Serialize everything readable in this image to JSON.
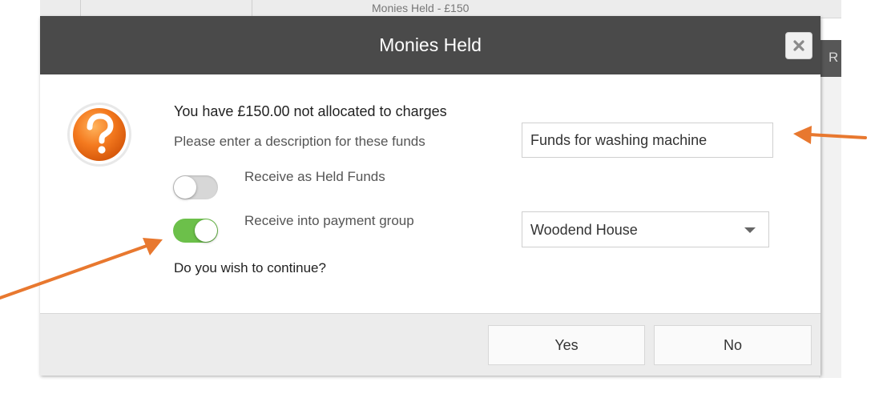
{
  "background": {
    "header_text": "Monies Held - £150",
    "right_tab_char": "R"
  },
  "dialog": {
    "title": "Monies Held",
    "close_icon": "close-icon",
    "question_icon": "question-icon",
    "message": "You have £150.00 not allocated to charges",
    "description_prompt": "Please enter a description for these funds",
    "description_value": "Funds for washing machine",
    "held_funds_label": "Receive as Held Funds",
    "held_funds_on": false,
    "payment_group_label": "Receive into payment group",
    "payment_group_on": true,
    "payment_group_selected": "Woodend House",
    "continue_prompt": "Do you wish to continue?",
    "yes_label": "Yes",
    "no_label": "No"
  },
  "colors": {
    "titlebar": "#4a4a4a",
    "toggle_on": "#6cc04a",
    "toggle_off": "#d7d7d7",
    "question_icon": "#f07a1c",
    "annotation_arrow": "#e8782f"
  }
}
